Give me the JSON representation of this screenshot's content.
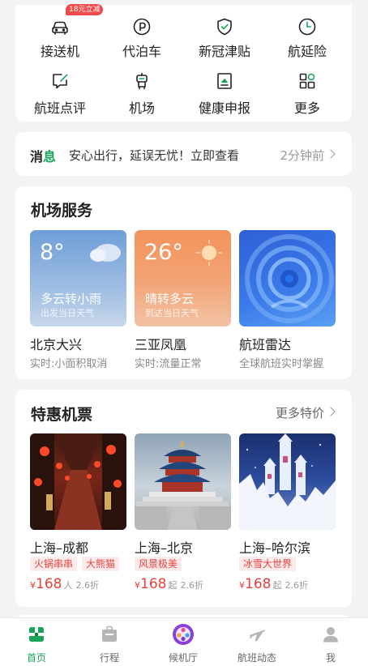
{
  "grid": {
    "items": [
      {
        "label": "接送机",
        "icon": "car-icon",
        "badge": "18元立减"
      },
      {
        "label": "代泊车",
        "icon": "parking-icon"
      },
      {
        "label": "新冠津贴",
        "icon": "shield-check-icon"
      },
      {
        "label": "航延险",
        "icon": "clock-icon"
      },
      {
        "label": "航班点评",
        "icon": "review-edit-icon"
      },
      {
        "label": "机场",
        "icon": "airport-robot-icon"
      },
      {
        "label": "健康申报",
        "icon": "health-declare-icon"
      },
      {
        "label": "更多",
        "icon": "more-grid-icon"
      }
    ]
  },
  "message": {
    "tag_part1": "消",
    "tag_part2": "息",
    "text": "安心出行，延误无忧！立即查看",
    "time": "2分钟前"
  },
  "services": {
    "title": "机场服务",
    "tiles": [
      {
        "big": "8°",
        "desc": "多云转小雨",
        "sub": "出发当日天气",
        "name": "北京大兴",
        "stat": "实时:小面积取消"
      },
      {
        "big": "26°",
        "desc": "晴转多云",
        "sub": "到达当日天气",
        "name": "三亚凤凰",
        "stat": "实时:流量正常"
      },
      {
        "name": "航班雷达",
        "stat": "全球航班实时掌握"
      }
    ]
  },
  "deals": {
    "title": "特惠机票",
    "more": "更多特价",
    "items": [
      {
        "route": "上海–成都",
        "tags": [
          "火锅串串",
          "大熊猫"
        ],
        "currency": "¥",
        "price": "168",
        "unit": "人",
        "discount": "2.6折"
      },
      {
        "route": "上海–北京",
        "tags": [
          "风景极美"
        ],
        "currency": "¥",
        "price": "168",
        "unit": "起",
        "discount": "2.6折"
      },
      {
        "route": "上海–哈尔滨",
        "tags": [
          "冰雪大世界"
        ],
        "currency": "¥",
        "price": "168",
        "unit": "起",
        "discount": "2.6折"
      }
    ]
  },
  "tabbar": {
    "tabs": [
      {
        "label": "首页",
        "icon": "home-icon",
        "active": true
      },
      {
        "label": "行程",
        "icon": "trip-icon"
      },
      {
        "label": "候机厅",
        "icon": "lounge-icon"
      },
      {
        "label": "航班动态",
        "icon": "flight-status-icon"
      },
      {
        "label": "我",
        "icon": "profile-icon"
      }
    ]
  },
  "colors": {
    "accent": "#1aa35a",
    "price_red": "#e8413c",
    "badge_red": "#f14a4a",
    "background": "#f2f3f5"
  }
}
